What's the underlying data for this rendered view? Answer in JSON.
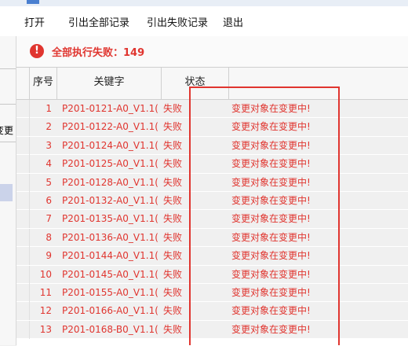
{
  "menu": {
    "open": "打开",
    "export_all": "引出全部记录",
    "export_failed": "引出失败记录",
    "exit": "退出"
  },
  "left_pane": {
    "truncated_text": "变更"
  },
  "status": {
    "icon_glyph": "!",
    "message": "全部执行失败：149"
  },
  "grid": {
    "columns": [
      "序号",
      "关键字",
      "状态",
      ""
    ],
    "rows": [
      {
        "num": "1",
        "key": "P201-0121-A0_V1.1(",
        "status": "失败",
        "message": "变更对象在变更中!"
      },
      {
        "num": "2",
        "key": "P201-0122-A0_V1.1(",
        "status": "失败",
        "message": "变更对象在变更中!"
      },
      {
        "num": "3",
        "key": "P201-0124-A0_V1.1(",
        "status": "失败",
        "message": "变更对象在变更中!"
      },
      {
        "num": "4",
        "key": "P201-0125-A0_V1.1(",
        "status": "失败",
        "message": "变更对象在变更中!"
      },
      {
        "num": "5",
        "key": "P201-0128-A0_V1.1(",
        "status": "失败",
        "message": "变更对象在变更中!"
      },
      {
        "num": "6",
        "key": "P201-0132-A0_V1.1(",
        "status": "失败",
        "message": "变更对象在变更中!"
      },
      {
        "num": "7",
        "key": "P201-0135-A0_V1.1(",
        "status": "失败",
        "message": "变更对象在变更中!"
      },
      {
        "num": "8",
        "key": "P201-0136-A0_V1.1(",
        "status": "失败",
        "message": "变更对象在变更中!"
      },
      {
        "num": "9",
        "key": "P201-0144-A0_V1.1(",
        "status": "失败",
        "message": "变更对象在变更中!"
      },
      {
        "num": "10",
        "key": "P201-0145-A0_V1.1(",
        "status": "失败",
        "message": "变更对象在变更中!"
      },
      {
        "num": "11",
        "key": "P201-0155-A0_V1.1(",
        "status": "失败",
        "message": "变更对象在变更中!"
      },
      {
        "num": "12",
        "key": "P201-0166-A0_V1.1(",
        "status": "失败",
        "message": "变更对象在变更中!"
      },
      {
        "num": "13",
        "key": "P201-0168-B0_V1.1(",
        "status": "失败",
        "message": "变更对象在变更中!"
      }
    ]
  },
  "colors": {
    "error_red": "#e0352f",
    "row_bg": "#f0f0f0",
    "selection_blue": "#cbd3ea"
  }
}
